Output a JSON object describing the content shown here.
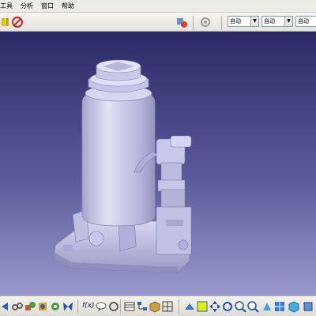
{
  "menu": {
    "items": [
      "工具",
      "分析",
      "窗口",
      "帮助"
    ]
  },
  "toolbar": {
    "combo1": "自动",
    "combo2": "自动",
    "combo3": "自动"
  },
  "bottom_toolbar": {
    "fx_label": "f(x)"
  },
  "colors": {
    "viewport_top": "#2a2a66",
    "viewport_bottom": "#9a9ad0",
    "model": "#c8c8e8"
  }
}
